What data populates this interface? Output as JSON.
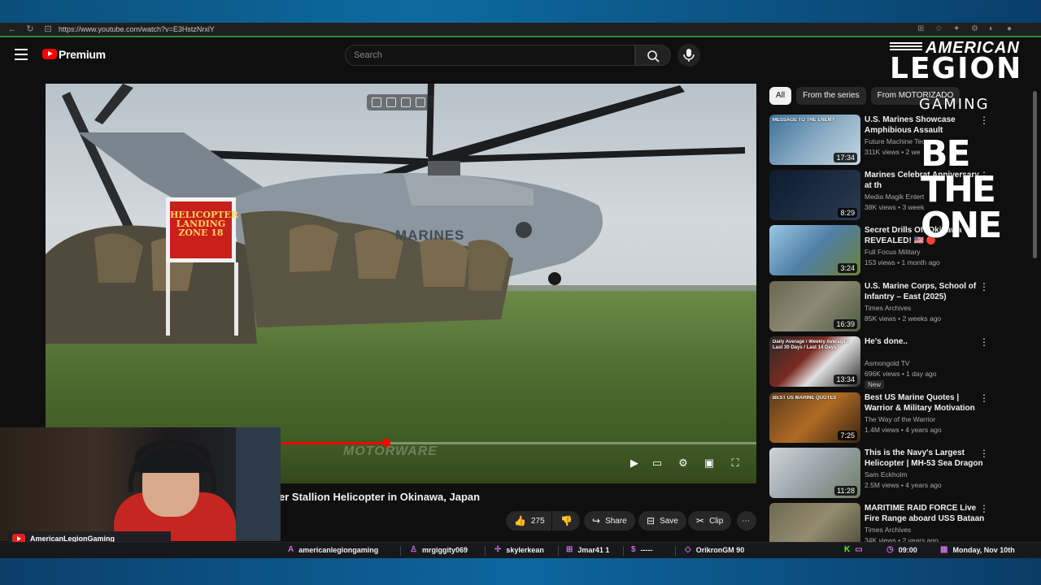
{
  "browser": {
    "url": "https://www.youtube.com/watch?v=E3HstzNrxlY"
  },
  "header": {
    "brand": "Premium",
    "search_placeholder": "Search"
  },
  "video": {
    "sign_text": "HELICOPTER LANDING ZONE 18",
    "fuselage_text": "MARINES",
    "watermark": "MOTORWARE",
    "progress_fraction": 0.37,
    "title": "er Stallion Helicopter in Okinawa, Japan"
  },
  "actions": {
    "likes": "275",
    "share": "Share",
    "save": "Save",
    "clip": "Clip"
  },
  "sidebar": {
    "chips": [
      "All",
      "From the series",
      "From MOTORIZADO"
    ],
    "items": [
      {
        "title": "U.S. Marines Showcase Amphibious Assault Capability...",
        "channel": "Future Machine Tec",
        "meta": "311K views • 2 we",
        "duration": "17:34",
        "thumb_text": "MESSAGE TO THE ENEMY"
      },
      {
        "title": "Marines Celebrat Anniversary at th",
        "channel": "Media Magik Entert",
        "meta": "38K views • 3 week",
        "duration": "8:29"
      },
      {
        "title": "Secret Drills Off Okinawa REVEALED! 🇺🇸 🔴",
        "channel": "Full Focus Military",
        "meta": "153 views • 1 month ago",
        "duration": "3:24"
      },
      {
        "title": "U.S. Marine Corps, School of Infantry – East (2025)",
        "channel": "Times Archives",
        "meta": "85K views • 2 weeks ago",
        "duration": "16:39"
      },
      {
        "title": "He's done..",
        "channel": "Asmongold TV",
        "meta": "696K views • 1 day ago",
        "duration": "13:34",
        "badge": "New",
        "thumb_text": "Daily Average / Weekly Average / Last 30 Days / Last 14 Days"
      },
      {
        "title": "Best US Marine Quotes | Warrior & Military Motivation",
        "channel": "The Way of the Warrior",
        "meta": "1.4M views • 4 years ago",
        "duration": "7:25",
        "thumb_text": "BEST US MARINE QUOTES"
      },
      {
        "title": "This is the Navy's Largest Helicopter | MH-53 Sea Dragon",
        "channel": "Sam Eckholm",
        "meta": "2.5M views • 4 years ago",
        "duration": "11:28"
      },
      {
        "title": "MARITIME RAID FORCE Live Fire Range aboard USS Bataan",
        "channel": "Times Archives",
        "meta": "34K views • 2 years ago",
        "duration": ""
      }
    ]
  },
  "overlay": {
    "american": "AMERICAN",
    "legion": "LEGION",
    "gaming": "GAMING",
    "be_the_one": "BE THE ONE",
    "streamer_name": "AmericanLegionGaming"
  },
  "ticker": {
    "items": [
      {
        "icon": "A",
        "text": "americanlegiongaming"
      },
      {
        "icon": "person-icon",
        "text": "mrgiggity069"
      },
      {
        "icon": "sparkle-icon",
        "text": "skylerkean"
      },
      {
        "icon": "gift-icon",
        "text": "Jmar41 1"
      },
      {
        "icon": "dollar-icon",
        "text": "-----"
      },
      {
        "icon": "diamond-icon",
        "text": "OrikronGM 90"
      }
    ],
    "time": "09:00",
    "date": "Monday, Nov 10th"
  },
  "colors": {
    "accent": "#ff0000",
    "background": "#0f0f0f",
    "ticker_purple": "#c471d9"
  }
}
